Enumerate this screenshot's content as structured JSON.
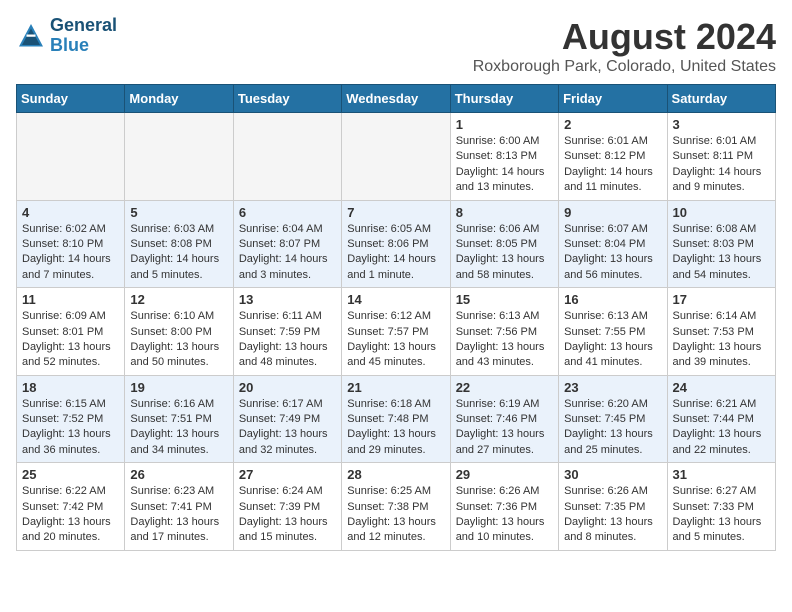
{
  "header": {
    "logo_line1": "General",
    "logo_line2": "Blue",
    "main_title": "August 2024",
    "subtitle": "Roxborough Park, Colorado, United States"
  },
  "days_of_week": [
    "Sunday",
    "Monday",
    "Tuesday",
    "Wednesday",
    "Thursday",
    "Friday",
    "Saturday"
  ],
  "weeks": [
    {
      "row_class": "row-odd",
      "cells": [
        {
          "empty": true
        },
        {
          "empty": true
        },
        {
          "empty": true
        },
        {
          "empty": true
        },
        {
          "num": "1",
          "line1": "Sunrise: 6:00 AM",
          "line2": "Sunset: 8:13 PM",
          "line3": "Daylight: 14 hours",
          "line4": "and 13 minutes."
        },
        {
          "num": "2",
          "line1": "Sunrise: 6:01 AM",
          "line2": "Sunset: 8:12 PM",
          "line3": "Daylight: 14 hours",
          "line4": "and 11 minutes."
        },
        {
          "num": "3",
          "line1": "Sunrise: 6:01 AM",
          "line2": "Sunset: 8:11 PM",
          "line3": "Daylight: 14 hours",
          "line4": "and 9 minutes."
        }
      ]
    },
    {
      "row_class": "row-even",
      "cells": [
        {
          "num": "4",
          "line1": "Sunrise: 6:02 AM",
          "line2": "Sunset: 8:10 PM",
          "line3": "Daylight: 14 hours",
          "line4": "and 7 minutes."
        },
        {
          "num": "5",
          "line1": "Sunrise: 6:03 AM",
          "line2": "Sunset: 8:08 PM",
          "line3": "Daylight: 14 hours",
          "line4": "and 5 minutes."
        },
        {
          "num": "6",
          "line1": "Sunrise: 6:04 AM",
          "line2": "Sunset: 8:07 PM",
          "line3": "Daylight: 14 hours",
          "line4": "and 3 minutes."
        },
        {
          "num": "7",
          "line1": "Sunrise: 6:05 AM",
          "line2": "Sunset: 8:06 PM",
          "line3": "Daylight: 14 hours",
          "line4": "and 1 minute."
        },
        {
          "num": "8",
          "line1": "Sunrise: 6:06 AM",
          "line2": "Sunset: 8:05 PM",
          "line3": "Daylight: 13 hours",
          "line4": "and 58 minutes."
        },
        {
          "num": "9",
          "line1": "Sunrise: 6:07 AM",
          "line2": "Sunset: 8:04 PM",
          "line3": "Daylight: 13 hours",
          "line4": "and 56 minutes."
        },
        {
          "num": "10",
          "line1": "Sunrise: 6:08 AM",
          "line2": "Sunset: 8:03 PM",
          "line3": "Daylight: 13 hours",
          "line4": "and 54 minutes."
        }
      ]
    },
    {
      "row_class": "row-odd",
      "cells": [
        {
          "num": "11",
          "line1": "Sunrise: 6:09 AM",
          "line2": "Sunset: 8:01 PM",
          "line3": "Daylight: 13 hours",
          "line4": "and 52 minutes."
        },
        {
          "num": "12",
          "line1": "Sunrise: 6:10 AM",
          "line2": "Sunset: 8:00 PM",
          "line3": "Daylight: 13 hours",
          "line4": "and 50 minutes."
        },
        {
          "num": "13",
          "line1": "Sunrise: 6:11 AM",
          "line2": "Sunset: 7:59 PM",
          "line3": "Daylight: 13 hours",
          "line4": "and 48 minutes."
        },
        {
          "num": "14",
          "line1": "Sunrise: 6:12 AM",
          "line2": "Sunset: 7:57 PM",
          "line3": "Daylight: 13 hours",
          "line4": "and 45 minutes."
        },
        {
          "num": "15",
          "line1": "Sunrise: 6:13 AM",
          "line2": "Sunset: 7:56 PM",
          "line3": "Daylight: 13 hours",
          "line4": "and 43 minutes."
        },
        {
          "num": "16",
          "line1": "Sunrise: 6:13 AM",
          "line2": "Sunset: 7:55 PM",
          "line3": "Daylight: 13 hours",
          "line4": "and 41 minutes."
        },
        {
          "num": "17",
          "line1": "Sunrise: 6:14 AM",
          "line2": "Sunset: 7:53 PM",
          "line3": "Daylight: 13 hours",
          "line4": "and 39 minutes."
        }
      ]
    },
    {
      "row_class": "row-even",
      "cells": [
        {
          "num": "18",
          "line1": "Sunrise: 6:15 AM",
          "line2": "Sunset: 7:52 PM",
          "line3": "Daylight: 13 hours",
          "line4": "and 36 minutes."
        },
        {
          "num": "19",
          "line1": "Sunrise: 6:16 AM",
          "line2": "Sunset: 7:51 PM",
          "line3": "Daylight: 13 hours",
          "line4": "and 34 minutes."
        },
        {
          "num": "20",
          "line1": "Sunrise: 6:17 AM",
          "line2": "Sunset: 7:49 PM",
          "line3": "Daylight: 13 hours",
          "line4": "and 32 minutes."
        },
        {
          "num": "21",
          "line1": "Sunrise: 6:18 AM",
          "line2": "Sunset: 7:48 PM",
          "line3": "Daylight: 13 hours",
          "line4": "and 29 minutes."
        },
        {
          "num": "22",
          "line1": "Sunrise: 6:19 AM",
          "line2": "Sunset: 7:46 PM",
          "line3": "Daylight: 13 hours",
          "line4": "and 27 minutes."
        },
        {
          "num": "23",
          "line1": "Sunrise: 6:20 AM",
          "line2": "Sunset: 7:45 PM",
          "line3": "Daylight: 13 hours",
          "line4": "and 25 minutes."
        },
        {
          "num": "24",
          "line1": "Sunrise: 6:21 AM",
          "line2": "Sunset: 7:44 PM",
          "line3": "Daylight: 13 hours",
          "line4": "and 22 minutes."
        }
      ]
    },
    {
      "row_class": "row-odd",
      "cells": [
        {
          "num": "25",
          "line1": "Sunrise: 6:22 AM",
          "line2": "Sunset: 7:42 PM",
          "line3": "Daylight: 13 hours",
          "line4": "and 20 minutes."
        },
        {
          "num": "26",
          "line1": "Sunrise: 6:23 AM",
          "line2": "Sunset: 7:41 PM",
          "line3": "Daylight: 13 hours",
          "line4": "and 17 minutes."
        },
        {
          "num": "27",
          "line1": "Sunrise: 6:24 AM",
          "line2": "Sunset: 7:39 PM",
          "line3": "Daylight: 13 hours",
          "line4": "and 15 minutes."
        },
        {
          "num": "28",
          "line1": "Sunrise: 6:25 AM",
          "line2": "Sunset: 7:38 PM",
          "line3": "Daylight: 13 hours",
          "line4": "and 12 minutes."
        },
        {
          "num": "29",
          "line1": "Sunrise: 6:26 AM",
          "line2": "Sunset: 7:36 PM",
          "line3": "Daylight: 13 hours",
          "line4": "and 10 minutes."
        },
        {
          "num": "30",
          "line1": "Sunrise: 6:26 AM",
          "line2": "Sunset: 7:35 PM",
          "line3": "Daylight: 13 hours",
          "line4": "and 8 minutes."
        },
        {
          "num": "31",
          "line1": "Sunrise: 6:27 AM",
          "line2": "Sunset: 7:33 PM",
          "line3": "Daylight: 13 hours",
          "line4": "and 5 minutes."
        }
      ]
    }
  ]
}
